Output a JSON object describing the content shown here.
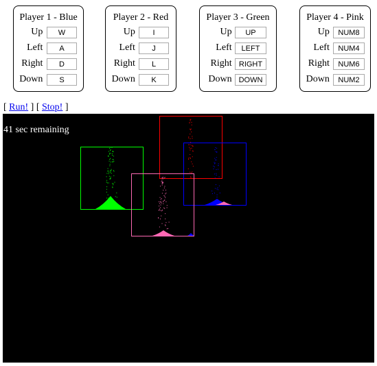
{
  "players": [
    {
      "title": "Player 1 - Blue",
      "controls": [
        {
          "label": "Up",
          "key": "W"
        },
        {
          "label": "Left",
          "key": "A"
        },
        {
          "label": "Right",
          "key": "D"
        },
        {
          "label": "Down",
          "key": "S"
        }
      ]
    },
    {
      "title": "Player 2 - Red",
      "controls": [
        {
          "label": "Up",
          "key": "I"
        },
        {
          "label": "Left",
          "key": "J"
        },
        {
          "label": "Right",
          "key": "L"
        },
        {
          "label": "Down",
          "key": "K"
        }
      ]
    },
    {
      "title": "Player 3 - Green",
      "controls": [
        {
          "label": "Up",
          "key": "UP"
        },
        {
          "label": "Left",
          "key": "LEFT"
        },
        {
          "label": "Right",
          "key": "RIGHT"
        },
        {
          "label": "Down",
          "key": "DOWN"
        }
      ]
    },
    {
      "title": "Player 4 - Pink",
      "controls": [
        {
          "label": "Up",
          "key": "NUM8"
        },
        {
          "label": "Left",
          "key": "NUM4"
        },
        {
          "label": "Right",
          "key": "NUM6"
        },
        {
          "label": "Down",
          "key": "NUM2"
        }
      ]
    }
  ],
  "actions": {
    "open_bracket": "[ ",
    "run": "Run!",
    "between": " ] [ ",
    "stop": "Stop!",
    "close_bracket": " ]"
  },
  "game": {
    "status": "41 sec remaining",
    "colors": {
      "background": "#000000",
      "blue": "#0000ff",
      "red": "#ff0000",
      "green": "#00ff00",
      "pink": "#ff69b4"
    }
  }
}
